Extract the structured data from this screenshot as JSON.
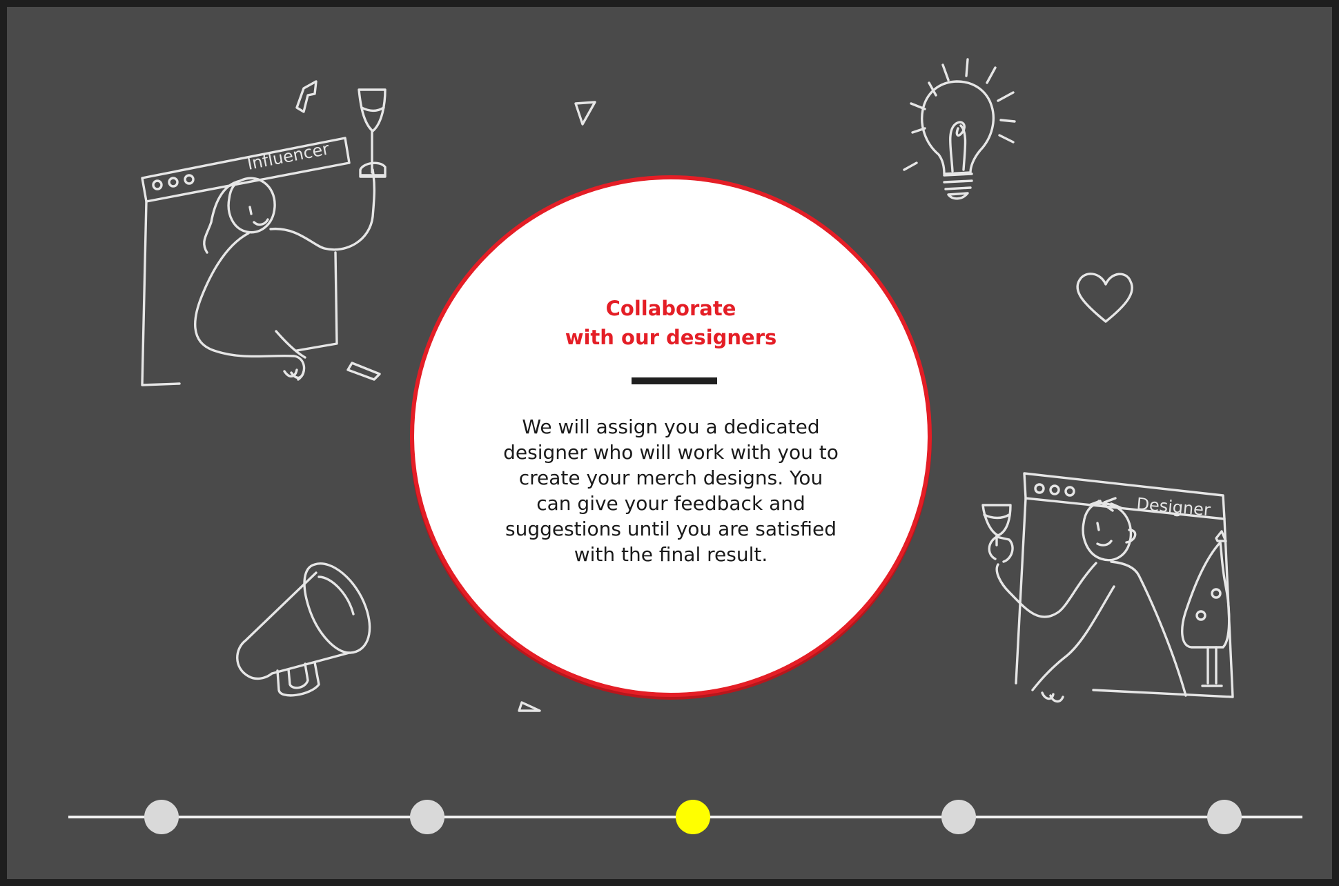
{
  "card": {
    "title": "Collaborate\nwith our designers",
    "body": "We will assign you a dedicated\ndesigner who will  work with you to\ncreate your merch designs. You\ncan give your feedback and\nsuggestions until you are satisfied\nwith the final result."
  },
  "illustrations": {
    "influencer_window_label": "Influencer",
    "designer_window_label": "Designer"
  },
  "timeline": {
    "step_count": 5,
    "active_step": 3
  },
  "colors": {
    "background": "#4a4a4a",
    "accent_red": "#e41e26",
    "active_step": "#ffff00",
    "inactive_step": "#d9d9d9",
    "doodle_stroke": "#e6e6e6"
  }
}
